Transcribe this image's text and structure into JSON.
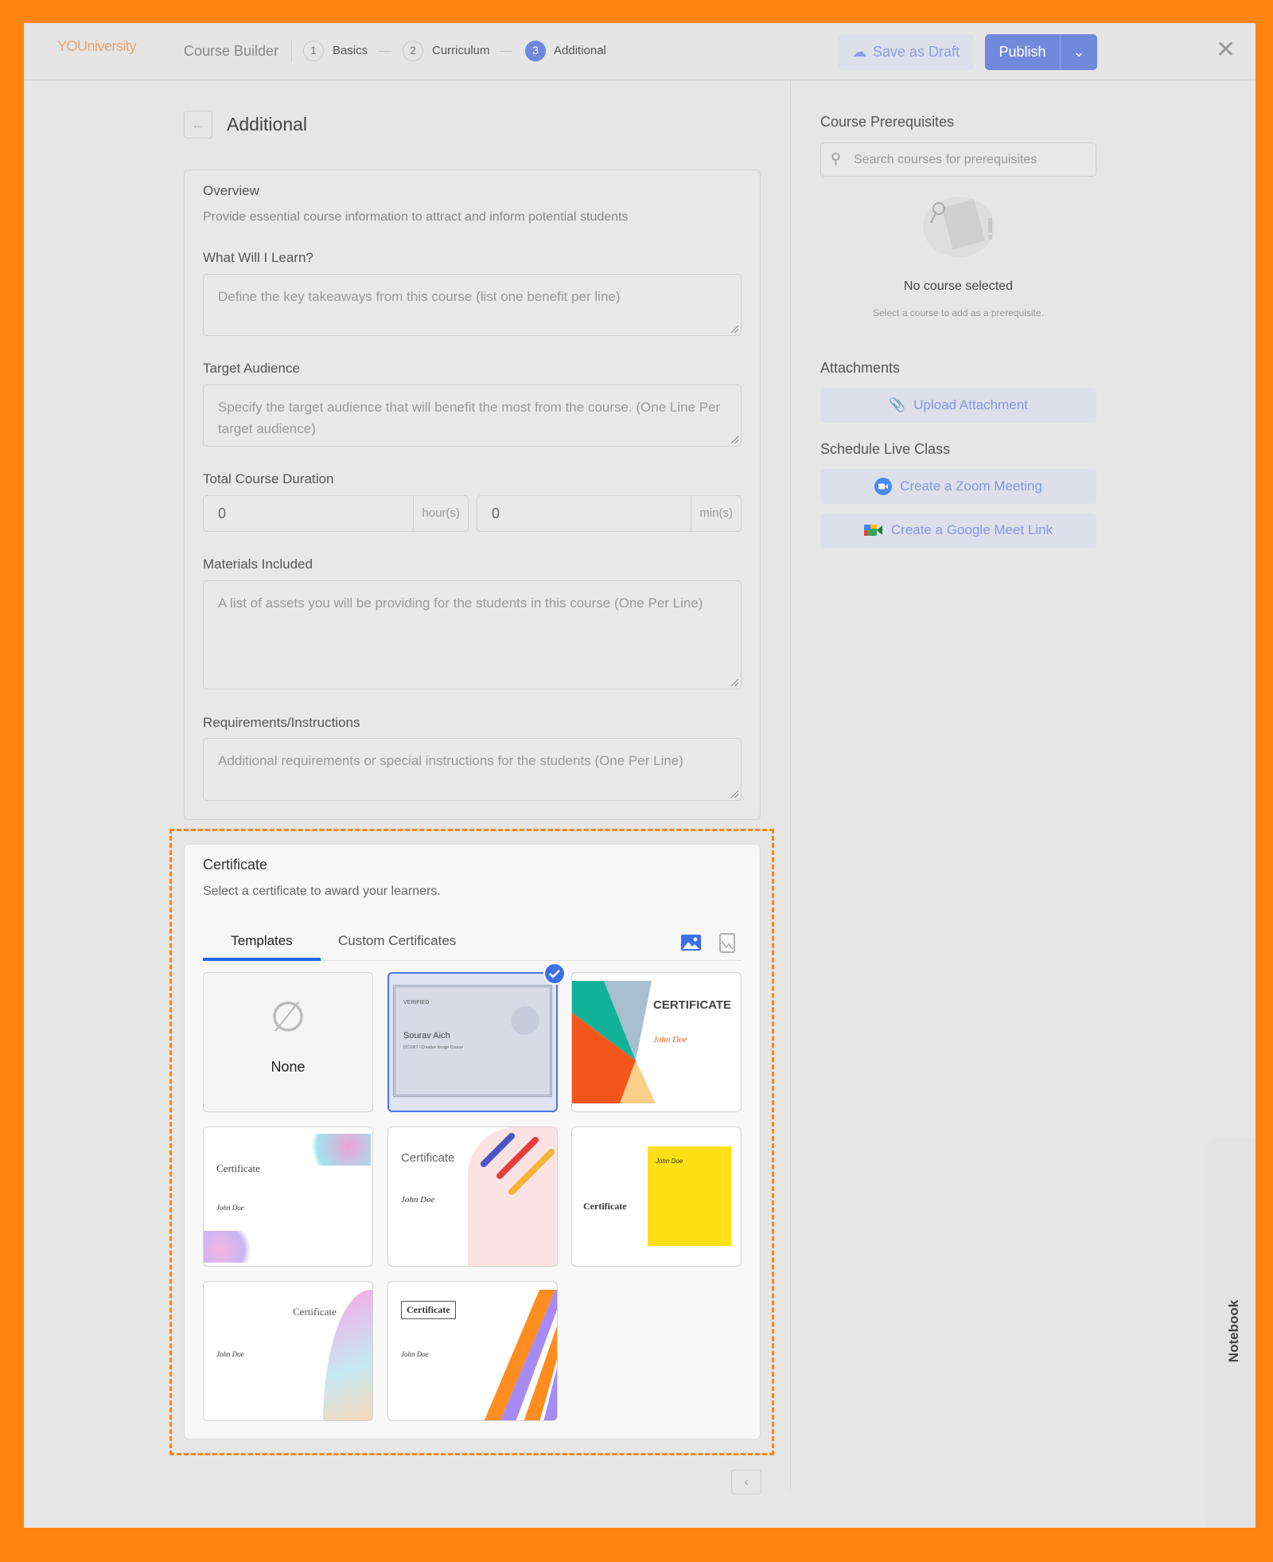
{
  "header": {
    "logo": "YOUniversity",
    "app_title": "Course Builder",
    "steps": [
      {
        "num": "1",
        "label": "Basics"
      },
      {
        "num": "2",
        "label": "Curriculum"
      },
      {
        "num": "3",
        "label": "Additional",
        "active": true
      }
    ],
    "save_draft": "Save as Draft",
    "publish": "Publish"
  },
  "page": {
    "title": "Additional"
  },
  "overview": {
    "title": "Overview",
    "description": "Provide essential course information to attract and inform potential students",
    "learn_label": "What Will I Learn?",
    "learn_placeholder": "Define the key takeaways from this course (list one benefit per line)",
    "audience_label": "Target Audience",
    "audience_placeholder": "Specify the target audience that will benefit the most from the course. (One Line Per target audience)",
    "duration_label": "Total Course Duration",
    "hours_value": "0",
    "hours_unit": "hour(s)",
    "minutes_value": "0",
    "minutes_unit": "min(s)",
    "materials_label": "Materials Included",
    "materials_placeholder": "A list of assets you will be providing for the students in this course (One Per Line)",
    "requirements_label": "Requirements/Instructions",
    "requirements_placeholder": "Additional requirements or special instructions for the students (One Per Line)"
  },
  "certificate": {
    "title": "Certificate",
    "description": "Select a certificate to award your learners.",
    "tabs": [
      {
        "label": "Templates",
        "active": true
      },
      {
        "label": "Custom Certificates"
      }
    ],
    "none_label": "None",
    "selected_index": 1,
    "templates": [
      {
        "kind": "verified",
        "heading": "VERIFIED",
        "name": "Sourav Aich",
        "course": "DC1087 / Creative design Course"
      },
      {
        "kind": "geometric",
        "heading": "CERTIFICATE",
        "name": "John Doe"
      },
      {
        "kind": "floral",
        "heading": "Certificate",
        "name": "John Doe"
      },
      {
        "kind": "stripes",
        "heading": "Certificate",
        "name": "John Doe"
      },
      {
        "kind": "yellow",
        "heading": "Certificate",
        "name": "John Doe"
      },
      {
        "kind": "wave",
        "heading": "Certificate",
        "name": "John Doe"
      },
      {
        "kind": "diagonal",
        "heading": "Certificate",
        "name": "John Doe"
      }
    ],
    "accent": "#4d74ee"
  },
  "sidebar": {
    "prereq_title": "Course Prerequisites",
    "search_placeholder": "Search courses for prerequisites",
    "empty_title": "No course selected",
    "empty_sub": "Select a course to add as a prerequisite.",
    "attachments_title": "Attachments",
    "upload": "Upload Attachment",
    "live_title": "Schedule Live Class",
    "zoom": "Create a Zoom Meeting",
    "meet": "Create a Google Meet Link"
  },
  "notebook": "Notebook",
  "colors": {
    "frame": "#ff8412",
    "primary": "#7189dc"
  }
}
